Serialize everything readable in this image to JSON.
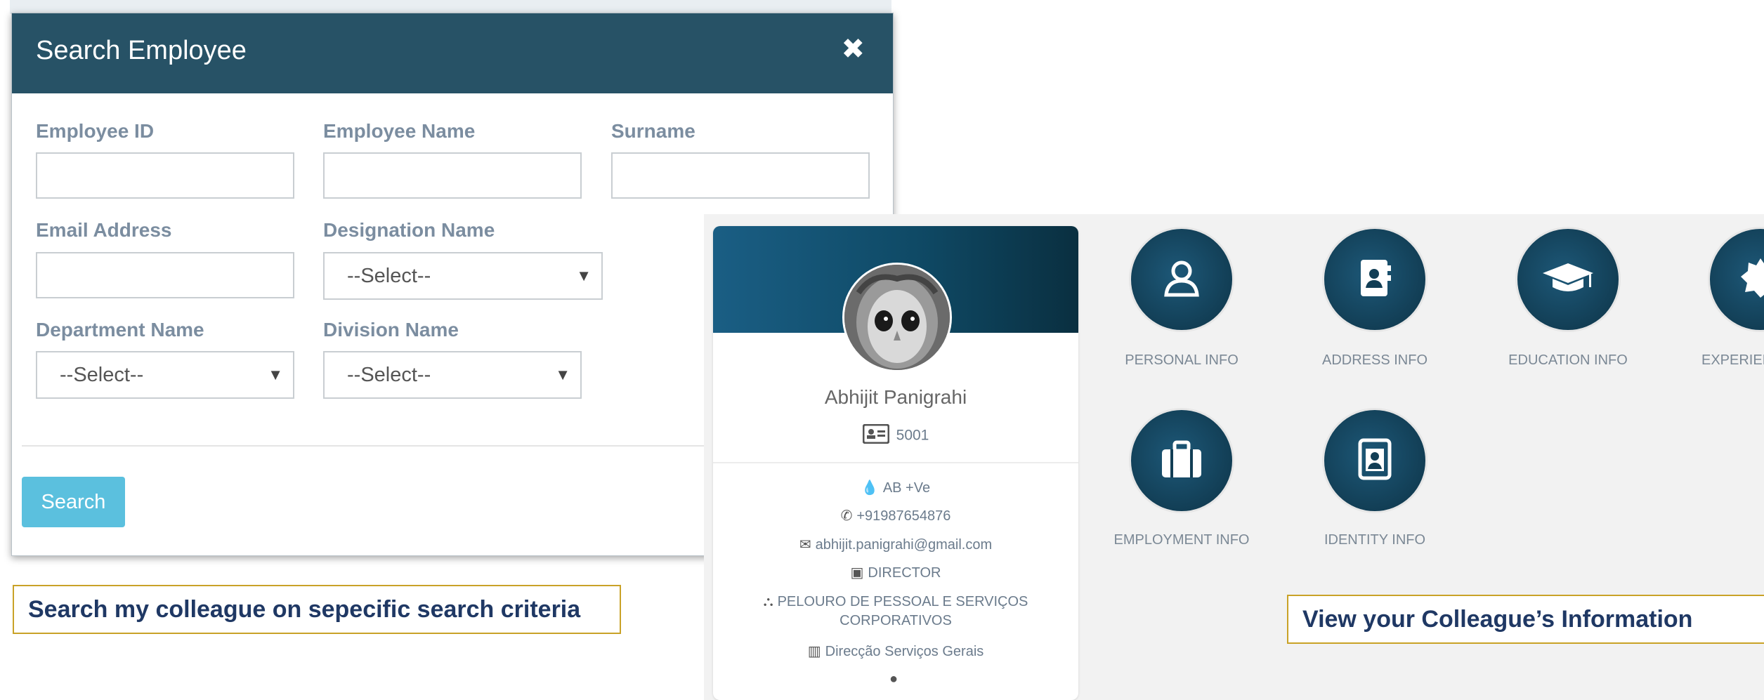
{
  "modal": {
    "title": "Search Employee",
    "close_glyph": "✖",
    "fields": {
      "employee_id": {
        "label": "Employee ID",
        "value": ""
      },
      "employee_name": {
        "label": "Employee Name",
        "value": ""
      },
      "surname": {
        "label": "Surname",
        "value": ""
      },
      "email": {
        "label": "Email Address",
        "value": ""
      },
      "designation": {
        "label": "Designation Name",
        "selected": "--Select--"
      },
      "department": {
        "label": "Department Name",
        "selected": "--Select--"
      },
      "division": {
        "label": "Division Name",
        "selected": "--Select--"
      }
    },
    "search_button": "Search"
  },
  "captions": {
    "search": "Search  my colleague on sepecific search  criteria",
    "view": "View  your  Colleague’s  Information"
  },
  "profile": {
    "name": "Abhijit Panigrahi",
    "employee_id": "5001",
    "blood_group": "AB +Ve",
    "phone": "+91987654876",
    "email": "abhijit.panigrahi@gmail.com",
    "designation": "DIRECTOR",
    "department": "PELOURO DE PESSOAL E SERVIÇOS CORPORATIVOS",
    "division": "Direcção Serviços Gerais"
  },
  "tiles": [
    {
      "label": "PERSONAL INFO",
      "icon": "person-icon"
    },
    {
      "label": "ADDRESS INFO",
      "icon": "address-book-icon"
    },
    {
      "label": "EDUCATION INFO",
      "icon": "graduation-cap-icon"
    },
    {
      "label": "EXPERIEN",
      "icon": "badge-icon"
    },
    {
      "label": "EMPLOYMENT INFO",
      "icon": "briefcase-icon"
    },
    {
      "label": "IDENTITY INFO",
      "icon": "id-badge-icon"
    }
  ],
  "colors": {
    "modal_header": "#275266",
    "search_button": "#5bc0de",
    "caption_border": "#c9a227",
    "caption_text": "#1f3864",
    "tile": "#123e55"
  }
}
